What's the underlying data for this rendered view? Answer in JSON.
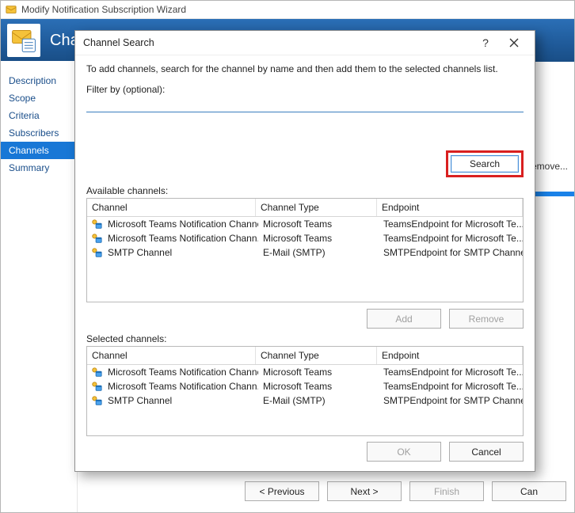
{
  "wizard": {
    "title": "Modify Notification Subscription Wizard",
    "header_title": "Cha",
    "sidebar": [
      {
        "label": "Description",
        "selected": false
      },
      {
        "label": "Scope",
        "selected": false
      },
      {
        "label": "Criteria",
        "selected": false
      },
      {
        "label": "Subscribers",
        "selected": false
      },
      {
        "label": "Channels",
        "selected": true
      },
      {
        "label": "Summary",
        "selected": false
      }
    ],
    "right_button": "Remove...",
    "footer": {
      "previous": "< Previous",
      "next": "Next >",
      "finish": "Finish",
      "cancel": "Can"
    }
  },
  "dialog": {
    "title": "Channel Search",
    "help_icon": "?",
    "instruction": "To add channels, search for the channel by name and then add them to the selected channels list.",
    "filter_label": "Filter by (optional):",
    "filter_value": "",
    "search_label": "Search",
    "available_label": "Available channels:",
    "selected_label": "Selected channels:",
    "columns": {
      "channel": "Channel",
      "type": "Channel Type",
      "endpoint": "Endpoint"
    },
    "available_rows": [
      {
        "channel": "Microsoft Teams Notification Channel",
        "type": "Microsoft Teams",
        "endpoint": "TeamsEndpoint for Microsoft Te..."
      },
      {
        "channel": "Microsoft Teams Notification Chann...",
        "type": "Microsoft Teams",
        "endpoint": "TeamsEndpoint for Microsoft Te..."
      },
      {
        "channel": "SMTP Channel",
        "type": "E-Mail (SMTP)",
        "endpoint": "SMTPEndpoint for SMTP Channel"
      }
    ],
    "selected_rows": [
      {
        "channel": "Microsoft Teams Notification Channel",
        "type": "Microsoft Teams",
        "endpoint": "TeamsEndpoint for Microsoft Te..."
      },
      {
        "channel": "Microsoft Teams Notification Chann...",
        "type": "Microsoft Teams",
        "endpoint": "TeamsEndpoint for Microsoft Te..."
      },
      {
        "channel": "SMTP Channel",
        "type": "E-Mail (SMTP)",
        "endpoint": "SMTPEndpoint for SMTP Channel"
      }
    ],
    "add_label": "Add",
    "remove_label": "Remove",
    "ok_label": "OK",
    "cancel_label": "Cancel"
  }
}
